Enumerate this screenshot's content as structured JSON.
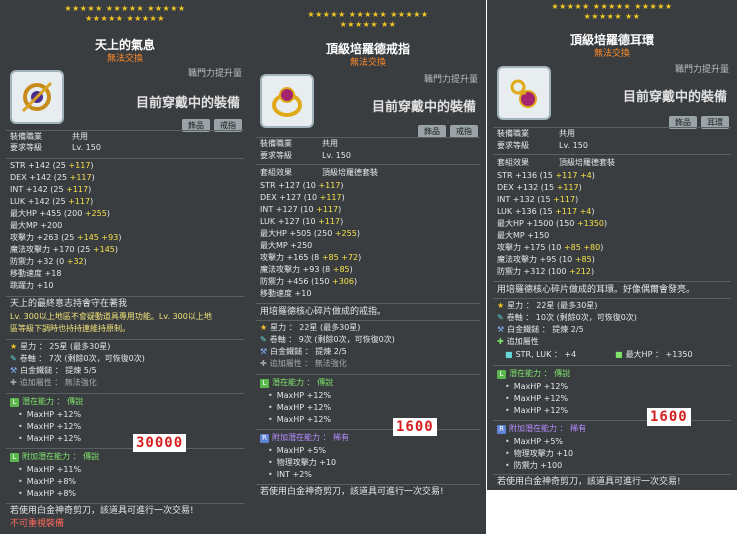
{
  "panels": [
    {
      "stars_row1": "★★★★★ ★★★★★ ★★★★★",
      "stars_row2": "★★★★★ ★★★★★",
      "title": "天上的氣息",
      "subtitle": "無法交換",
      "job_bar": "職門力提升量",
      "wearing": "目前穿戴中的裝備",
      "tags": [
        "飾品",
        "戒指"
      ],
      "job_label": "裝備職業",
      "job_value": "共用",
      "req_label": "要求等級",
      "req_value": "Lv. 150",
      "stats": [
        [
          "STR",
          "+142 (25 ",
          "+117",
          ")"
        ],
        [
          "DEX",
          "+142 (25 ",
          "+117",
          ")"
        ],
        [
          "INT",
          "+142 (25 ",
          "+117",
          ")"
        ],
        [
          "LUK",
          "+142 (25 ",
          "+117",
          ")"
        ],
        [
          "最大HP",
          "+455 (200 ",
          "+255",
          ")"
        ],
        [
          "最大MP",
          "+200",
          "",
          ""
        ],
        [
          "攻擊力",
          "+263 (25 ",
          "+145 +93",
          ")"
        ],
        [
          "魔法攻擊力",
          "+170 (25 ",
          "+145",
          ")"
        ],
        [
          "防禦力",
          "+32 (0 ",
          "+32",
          ")"
        ],
        [
          "移動速度",
          "+18",
          "",
          ""
        ],
        [
          "跳躍力",
          "+10",
          "",
          ""
        ]
      ],
      "desc": "天上的最終意志持會守在著我",
      "lvnote1": "Lv. 300以上地區不會疑動道具專用功能。Lv. 300以上地",
      "lvnote2": "區等級下調時也持持連維持原制。",
      "star_force": "星力 ： 25星 (最多30星)",
      "scroll": "卷軸 ： 7次 (剩餘0次，可恢復0次)",
      "hammer": "白金鐵鎚 ： 提煉 5/5",
      "extra": "追加屬性 ： 無法強化",
      "potential_title": "潛在能力 ： 傳說",
      "potential": [
        "MaxHP +12%",
        "MaxHP +12%",
        "MaxHP +12%"
      ],
      "bonus_title": "附加潛在能力 ： 傳說",
      "bonus": [
        "MaxHP +11%",
        "MaxHP +8%",
        "MaxHP +8%"
      ],
      "footer": "若使用白金神奇剪刀，該道具可進行一次交易!",
      "footer2": "不可重視裝備",
      "price": "30000"
    },
    {
      "stars_row1": "★★★★★ ★★★★★ ★★★★★",
      "stars_row2": "★★★★★ ★★",
      "title": "頂級培羅德戒指",
      "subtitle": "無法交換",
      "job_bar": "職門力提升量",
      "wearing": "目前穿戴中的裝備",
      "tags": [
        "飾品",
        "戒指"
      ],
      "job_label": "裝備職業",
      "job_value": "共用",
      "req_label": "要求等級",
      "req_value": "Lv. 150",
      "set_label": "套組效果",
      "set_value": "頂級培羅德套裝",
      "stats": [
        [
          "STR",
          "+127 (10 ",
          "+117",
          ")"
        ],
        [
          "DEX",
          "+127 (10 ",
          "+117",
          ")"
        ],
        [
          "INT",
          "+127 (10 ",
          "+117",
          ")"
        ],
        [
          "LUK",
          "+127 (10 ",
          "+117",
          ")"
        ],
        [
          "最大HP",
          "+505 (250 ",
          "+255",
          ")"
        ],
        [
          "最大MP",
          "+250",
          "",
          ""
        ],
        [
          "攻擊力",
          "+165 (8 ",
          "+85 +72",
          ")"
        ],
        [
          "魔法攻擊力",
          "+93 (8 ",
          "+85",
          ")"
        ],
        [
          "防禦力",
          "+456 (150 ",
          "+306",
          ")"
        ],
        [
          "移動速度",
          "+10",
          "",
          ""
        ]
      ],
      "desc": "用培羅德核心碎片做成的戒指。",
      "star_force": "星力 ： 22星 (最多30星)",
      "scroll": "卷軸 ： 9次 (剩餘0次，可恢復0次)",
      "hammer": "白金鐵鎚 ： 提煉 2/5",
      "extra": "追加屬性 ： 無法強化",
      "potential_title": "潛在能力 ： 傳說",
      "potential": [
        "MaxHP +12%",
        "MaxHP +12%",
        "MaxHP +12%"
      ],
      "bonus_title": "附加潛在能力 ： 稀有",
      "bonus": [
        "MaxHP +5%",
        "物理攻擊力 +10",
        "INT +2%"
      ],
      "footer": "若使用白金神奇剪刀，該道具可進行一次交易!",
      "price": "1600"
    },
    {
      "stars_row1": "★★★★★ ★★★★★ ★★★★★",
      "stars_row2": "★★★★★ ★★",
      "title": "頂級培羅德耳環",
      "subtitle": "無法交換",
      "job_bar": "職門力提升量",
      "wearing": "目前穿戴中的裝備",
      "tags": [
        "飾品",
        "耳環"
      ],
      "job_label": "裝備職業",
      "job_value": "共用",
      "req_label": "要求等級",
      "req_value": "Lv. 150",
      "set_label": "套組效果",
      "set_value": "頂級培羅德套裝",
      "stats": [
        [
          "STR",
          "+136 (15 ",
          "+117 +4",
          ")"
        ],
        [
          "DEX",
          "+132 (15 ",
          "+117",
          ")"
        ],
        [
          "INT",
          "+132 (15 ",
          "+117",
          ")"
        ],
        [
          "LUK",
          "+136 (15 ",
          "+117 +4",
          ")"
        ],
        [
          "最大HP",
          "+1500 (150 ",
          "+1350",
          ")"
        ],
        [
          "最大MP",
          "+150",
          "",
          ""
        ],
        [
          "攻擊力",
          "+175 (10 ",
          "+85 +80",
          ")"
        ],
        [
          "魔法攻擊力",
          "+95 (10 ",
          "+85",
          ")"
        ],
        [
          "防禦力",
          "+312 (100 ",
          "+212",
          ")"
        ]
      ],
      "desc": "用培羅德核心碎片做成的耳環。好像偶爾會發亮。",
      "star_force": "星力 ： 22星 (最多30星)",
      "scroll": "卷軸 ： 10次 (剩餘0次，可恢復0次)",
      "hammer": "白金鐵鎚 ： 提煉 2/5",
      "extra": "追加屬性",
      "extra_detail_left": "STR, LUK  ： +4",
      "extra_detail_right": "最大HP  ： +1350",
      "potential_title": "潛在能力 ： 傳說",
      "potential": [
        "MaxHP +12%",
        "MaxHP +12%",
        "MaxHP +12%"
      ],
      "bonus_title": "附加潛在能力 ： 稀有",
      "bonus": [
        "MaxHP +5%",
        "物理攻擊力 +10",
        "防禦力 +100"
      ],
      "footer": "若使用白金神奇剪刀，該道具可進行一次交易!",
      "price": "1600"
    }
  ],
  "colors": {
    "panel_bg": "#3a3d40",
    "star": "#f3c623",
    "price_text": "#d62020"
  }
}
